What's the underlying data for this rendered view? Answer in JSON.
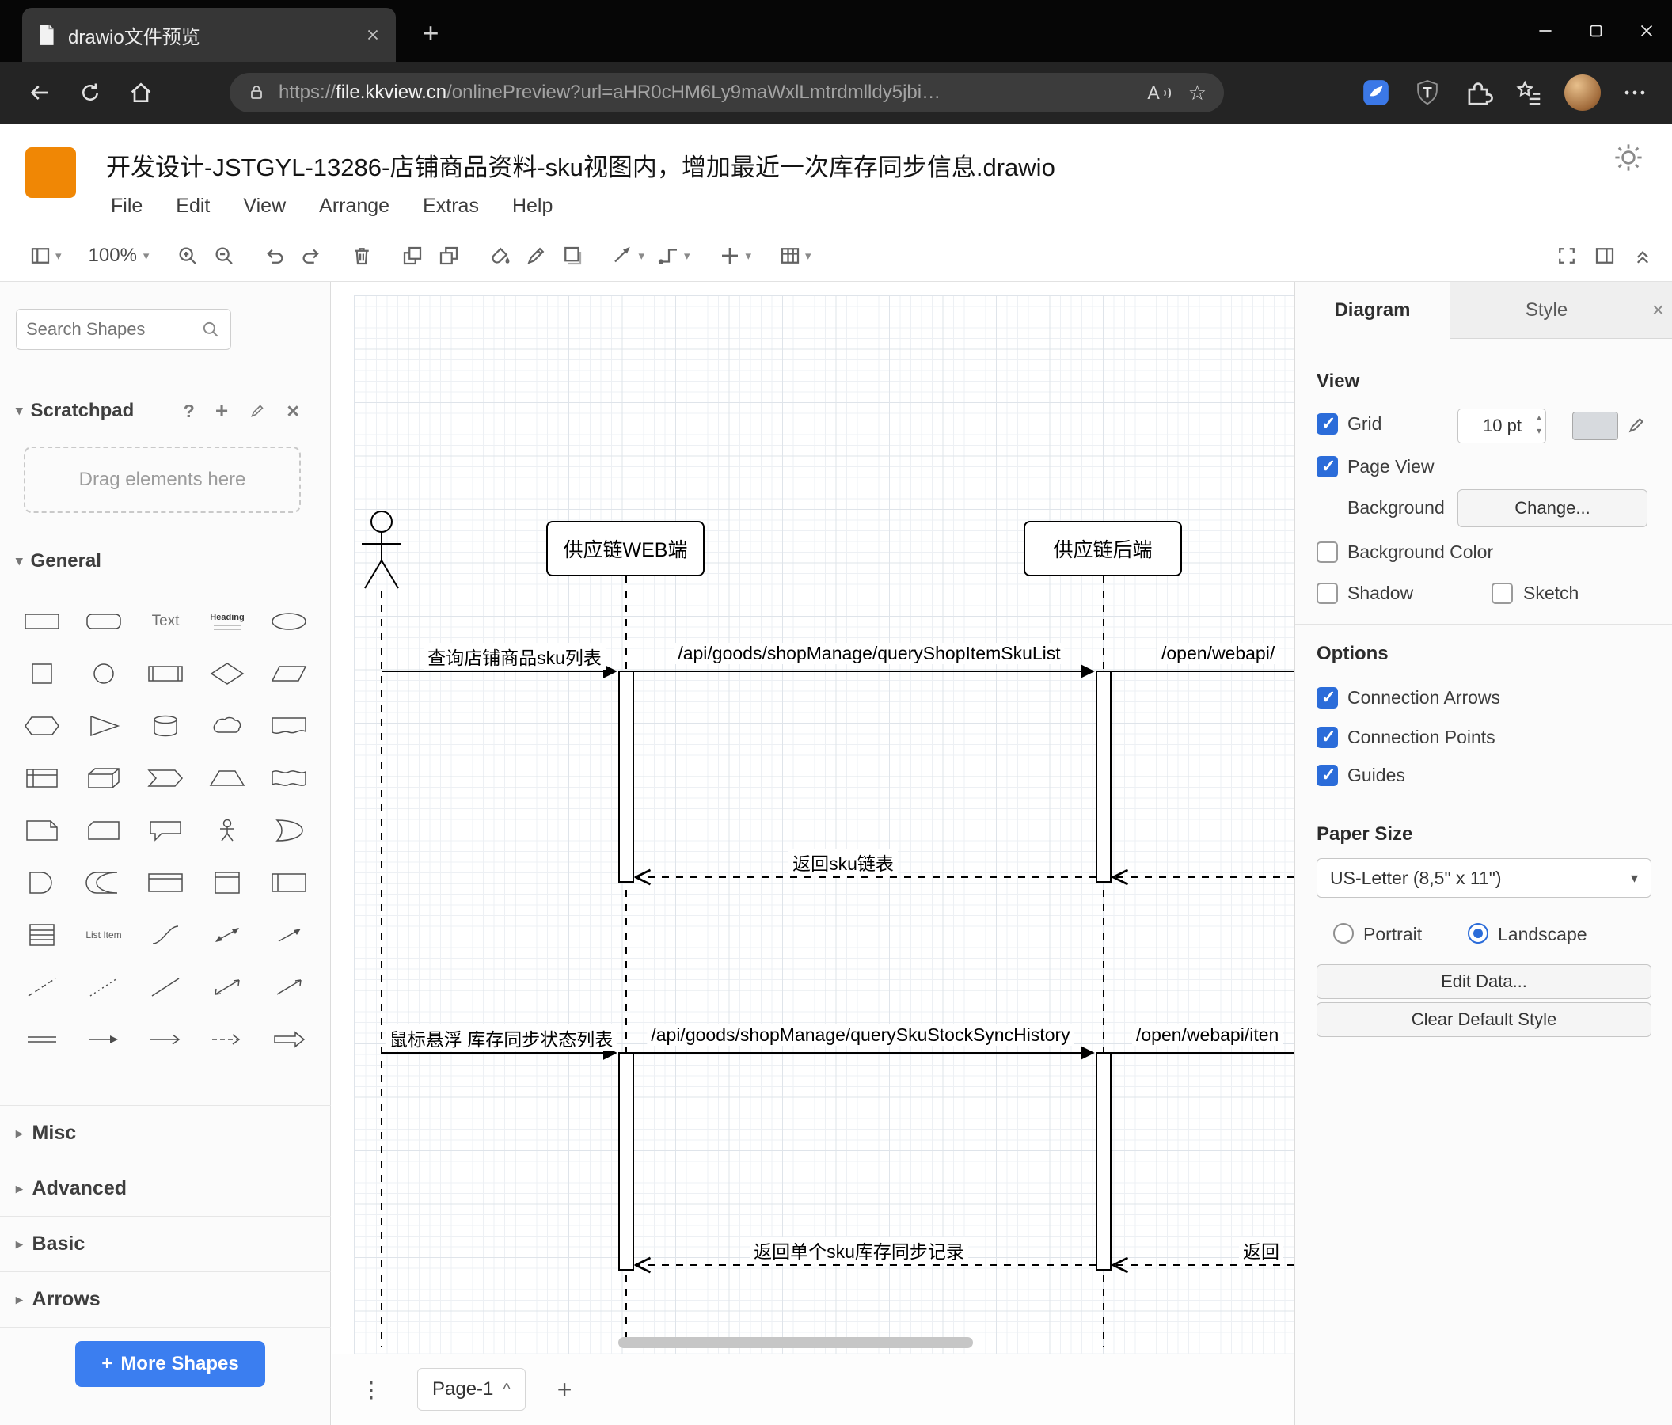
{
  "colors": {
    "accent_blue": "#2b6cd9",
    "drawio_orange": "#f08705",
    "more_shapes_blue": "#3b7ef0"
  },
  "icons": {
    "help": "?",
    "add": "+",
    "close": "×",
    "caret_down": "▾",
    "chevron_down": "▾",
    "chevron_right": "▸",
    "chevron_up": "^",
    "kebab": "⋮",
    "step_up": "▴",
    "step_down": "▾",
    "star": "☆"
  },
  "browser": {
    "tab_title": "drawio文件预览",
    "address": {
      "scheme": "https://",
      "host": "file.kkview.cn",
      "path": "/onlinePreview?url=aHR0cHM6Ly9maWxlLmtrdmlldy5jbi…"
    }
  },
  "app": {
    "title": "开发设计-JSTGYL-13286-店铺商品资料-sku视图内，增加最近一次库存同步信息.drawio",
    "menus": [
      "File",
      "Edit",
      "View",
      "Arrange",
      "Extras",
      "Help"
    ]
  },
  "toolbar": {
    "zoom": "100%"
  },
  "shapes": {
    "search_placeholder": "Search Shapes",
    "scratchpad_title": "Scratchpad",
    "scratchpad_hint": "Drag elements here",
    "sections": [
      "General",
      "Misc",
      "Advanced",
      "Basic",
      "Arrows"
    ],
    "labels": {
      "text": "Text",
      "textbox": "Heading",
      "list_item": "List Item"
    },
    "items": [
      "rectangle",
      "rounded-rectangle",
      "text",
      "textbox",
      "ellipse",
      "square",
      "circle",
      "process",
      "diamond",
      "parallelogram",
      "hexagon",
      "triangle",
      "cylinder",
      "cloud",
      "document",
      "internal-storage",
      "cube",
      "step",
      "trapezoid",
      "tape",
      "note",
      "card",
      "callout",
      "actor",
      "or",
      "and",
      "data-storage",
      "container",
      "vertical-container",
      "horizontal-pool",
      "list",
      "list-item",
      "curve",
      "bidirectional-arrow",
      "arrow",
      "dashed-line",
      "dotted-line",
      "line",
      "bidirectional-connector",
      "directional-connector",
      "link",
      "arrow-right",
      "simple-arrow",
      "dashed-arrow",
      "filled-edge"
    ],
    "more_shapes_plus": "+",
    "more_shapes": "More Shapes"
  },
  "canvas": {
    "lifelines": [
      "供应链WEB端",
      "供应链后端"
    ],
    "messages": {
      "query_sku_list": "查询店铺商品sku列表",
      "api_query_sku_list": "/api/goods/shopManage/queryShopItemSkuList",
      "ext_api_1": "/open/webapi/",
      "return_sku_list": "返回sku链表",
      "hover_stock_sync": "鼠标悬浮 库存同步状态列表",
      "api_stock_sync": "/api/goods/shopManage/querySkuStockSyncHistory",
      "ext_api_2": "/open/webapi/iten",
      "return_single_sku": "返回单个sku库存同步记录",
      "return_ext": "返回"
    },
    "page_tab": "Page-1"
  },
  "format": {
    "tabs": [
      "Diagram",
      "Style"
    ],
    "view": {
      "heading": "View",
      "grid_label": "Grid",
      "grid_checked": true,
      "grid_size": "10 pt",
      "page_view_label": "Page View",
      "page_view_checked": true,
      "background_label": "Background",
      "change_button": "Change...",
      "background_color_label": "Background Color",
      "background_color_checked": false,
      "shadow_label": "Shadow",
      "shadow_checked": false,
      "sketch_label": "Sketch",
      "sketch_checked": false
    },
    "options": {
      "heading": "Options",
      "items": [
        "Connection Arrows",
        "Connection Points",
        "Guides"
      ],
      "checked": [
        true,
        true,
        true
      ]
    },
    "paper": {
      "heading": "Paper Size",
      "value": "US-Letter (8,5\" x 11\")",
      "portrait_label": "Portrait",
      "portrait_selected": false,
      "landscape_label": "Landscape",
      "landscape_selected": true
    },
    "buttons": {
      "edit_data": "Edit Data...",
      "clear_default_style": "Clear Default Style"
    }
  }
}
